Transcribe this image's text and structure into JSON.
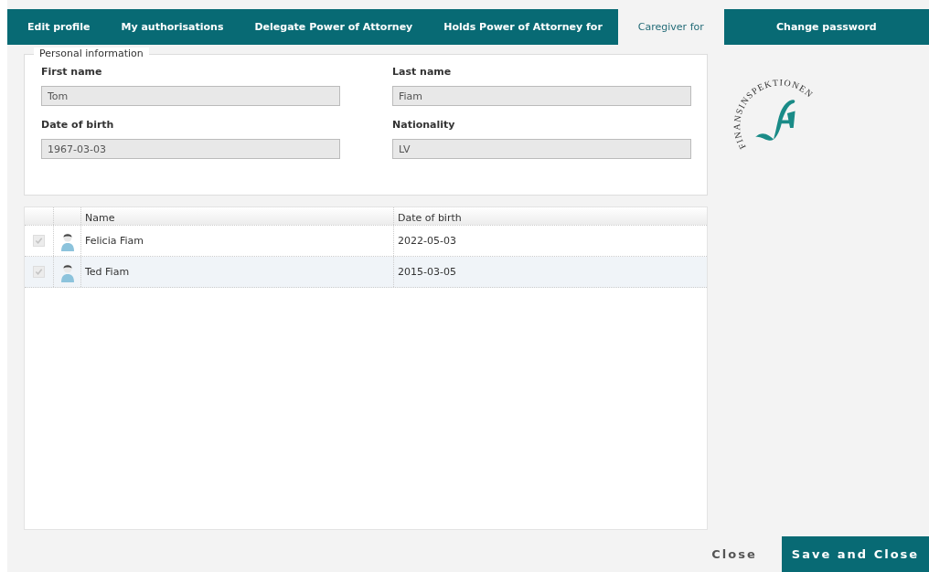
{
  "tabs": [
    {
      "label": "Edit profile",
      "selected": false
    },
    {
      "label": "My authorisations",
      "selected": false
    },
    {
      "label": "Delegate Power of Attorney",
      "selected": false
    },
    {
      "label": "Holds Power of Attorney for",
      "selected": false
    },
    {
      "label": "Caregiver for",
      "selected": true
    },
    {
      "label": "Change password",
      "selected": false
    }
  ],
  "personal_information": {
    "legend": "Personal information",
    "fields": [
      {
        "label": "First name",
        "value": "Tom",
        "disabled": true
      },
      {
        "label": "Last name",
        "value": "Fiam",
        "disabled": true
      },
      {
        "label": "Date of birth",
        "value": "1967-03-03",
        "disabled": true
      },
      {
        "label": "Nationality",
        "value": "LV",
        "disabled": true
      }
    ]
  },
  "logo": {
    "text": "FINANSINSPEKTIONEN"
  },
  "table": {
    "columns": [
      "Name",
      "Date of birth"
    ],
    "rows": [
      {
        "name": "Felicia Fiam",
        "date_of_birth": "2022-05-03",
        "checked": true,
        "selected": false
      },
      {
        "name": "Ted Fiam",
        "date_of_birth": "2015-03-05",
        "checked": true,
        "selected": true
      }
    ]
  },
  "buttons": {
    "close": "Close",
    "save": "Save and Close"
  }
}
